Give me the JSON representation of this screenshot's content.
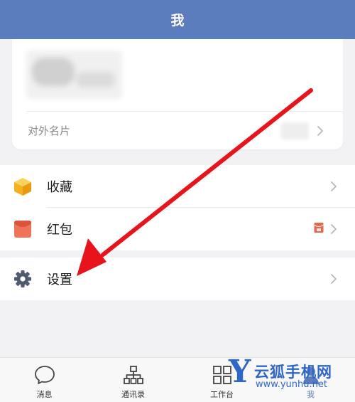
{
  "header": {
    "title": "我"
  },
  "profile": {
    "card_row_label": "对外名片"
  },
  "menu": {
    "favorites_label": "收藏",
    "redpacket_label": "红包",
    "settings_label": "设置"
  },
  "tabbar": {
    "tabs": [
      {
        "label": "消息",
        "icon": "chat-bubble-icon"
      },
      {
        "label": "通讯录",
        "icon": "org-tree-icon"
      },
      {
        "label": "工作台",
        "icon": "grid-icon"
      },
      {
        "label": "我",
        "icon": "person-icon"
      }
    ]
  },
  "watermark": {
    "letter": "Y",
    "name": "云狐手机网",
    "url": "www.yunhu.net"
  },
  "colors": {
    "header_bg": "#5b7cbd",
    "annotation_arrow": "#e8141b",
    "favorites_icon": "#f5b21e",
    "redpacket_icon": "#e9664a",
    "settings_icon": "#4f5a6e",
    "watermark": "#2f66c9"
  }
}
